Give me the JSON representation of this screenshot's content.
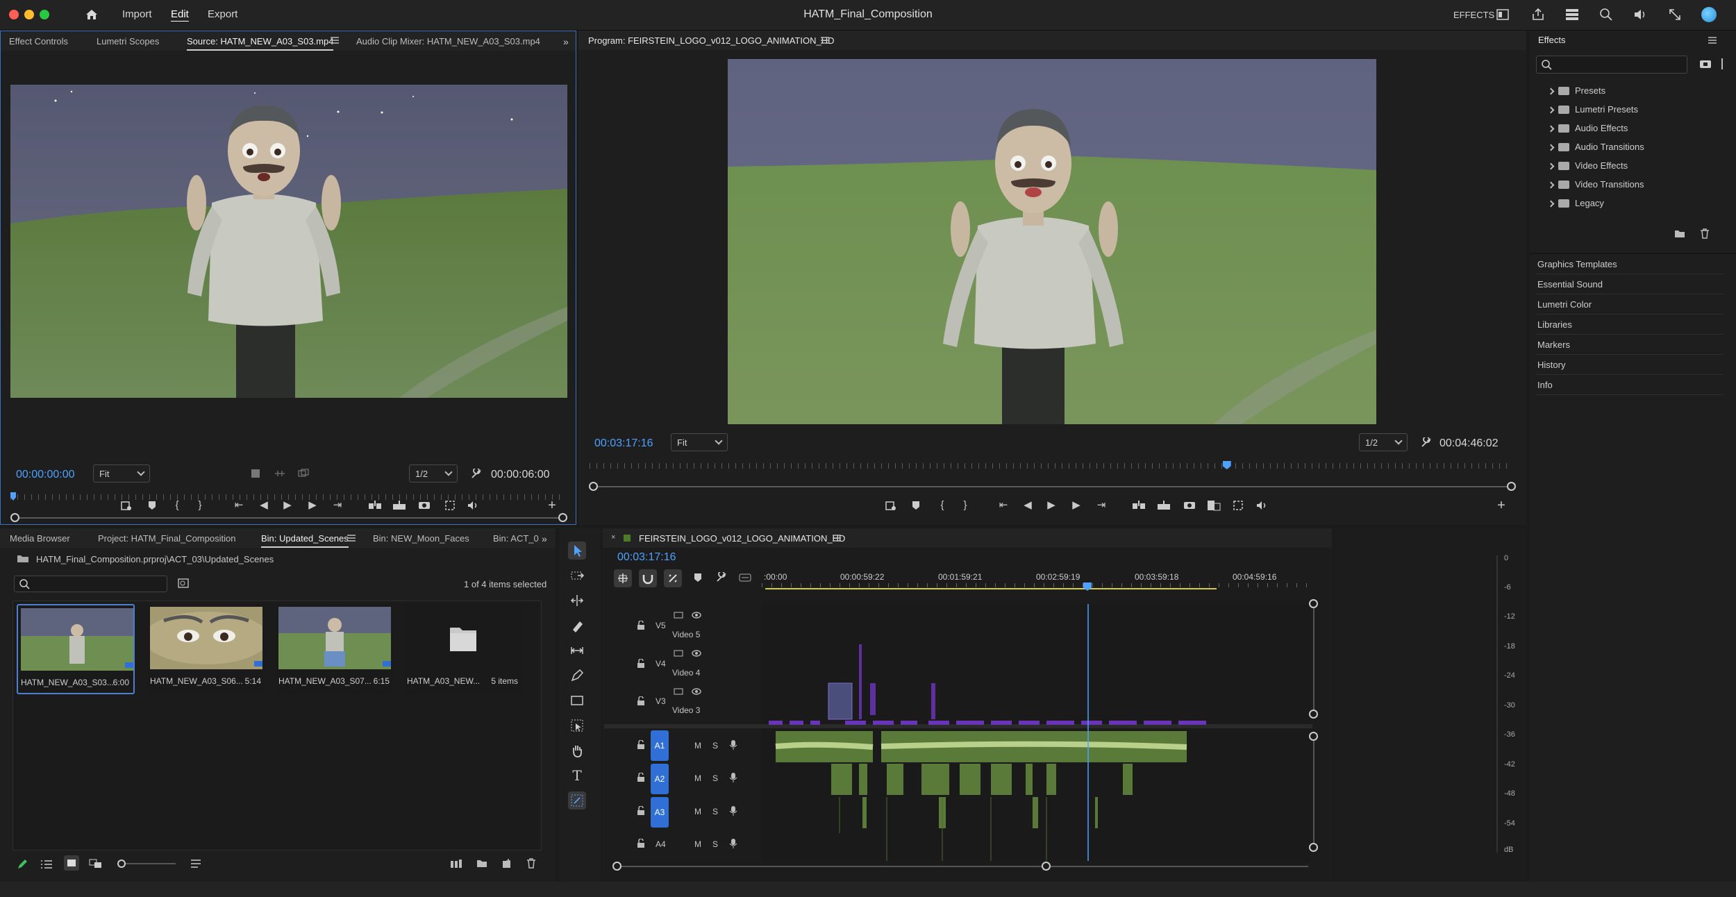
{
  "app": {
    "title": "HATM_Final_Composition",
    "menu": [
      "Import",
      "Edit",
      "Export"
    ],
    "workspace_label": "EFFECTS"
  },
  "source_panel": {
    "tabs": [
      "Effect Controls",
      "Lumetri Scopes",
      "Source: HATM_NEW_A03_S03.mp4",
      "Audio Clip Mixer: HATM_NEW_A03_S03.mp4"
    ],
    "timecode": "00:00:00:00",
    "fit": "Fit",
    "resolution": "1/2",
    "duration": "00:00:06:00"
  },
  "program_panel": {
    "title": "Program: FEIRSTEIN_LOGO_v012_LOGO_ANIMATION_HD",
    "timecode": "00:03:17:16",
    "fit": "Fit",
    "resolution": "1/2",
    "duration": "00:04:46:02",
    "playhead_fraction": 0.69
  },
  "effects_panel": {
    "title": "Effects",
    "search_placeholder": "",
    "folders": [
      "Presets",
      "Lumetri Presets",
      "Audio Effects",
      "Audio Transitions",
      "Video Effects",
      "Video Transitions",
      "Legacy"
    ],
    "sections": [
      "Graphics Templates",
      "Essential Sound",
      "Lumetri Color",
      "Libraries",
      "Markers",
      "History",
      "Info"
    ]
  },
  "project_panel": {
    "tabs": [
      "Media Browser",
      "Project: HATM_Final_Composition",
      "Bin: Updated_Scenes",
      "Bin: NEW_Moon_Faces",
      "Bin: ACT_0"
    ],
    "path": "HATM_Final_Composition.prproj\\ACT_03\\Updated_Scenes",
    "selection_status": "1 of 4 items selected",
    "items": [
      {
        "name": "HATM_NEW_A03_S03...",
        "meta": "6:00"
      },
      {
        "name": "HATM_NEW_A03_S06...",
        "meta": "5:14"
      },
      {
        "name": "HATM_NEW_A03_S07...",
        "meta": "6:15"
      },
      {
        "name": "HATM_A03_NEW...",
        "meta": "5 items"
      }
    ]
  },
  "timeline": {
    "sequence_name": "FEIRSTEIN_LOGO_v012_LOGO_ANIMATION_HD",
    "timecode": "00:03:17:16",
    "ruler_labels": [
      ":00:00",
      "00:00:59:22",
      "00:01:59:21",
      "00:02:59:19",
      "00:03:59:18",
      "00:04:59:16"
    ],
    "video_tracks": [
      {
        "id": "V5",
        "name": "Video 5"
      },
      {
        "id": "V4",
        "name": "Video 4"
      },
      {
        "id": "V3",
        "name": "Video 3"
      }
    ],
    "audio_tracks": [
      {
        "id": "A1",
        "m": "M",
        "s": "S"
      },
      {
        "id": "A2",
        "m": "M",
        "s": "S"
      },
      {
        "id": "A3",
        "m": "M",
        "s": "S"
      },
      {
        "id": "A4",
        "m": "M",
        "s": "S"
      }
    ]
  },
  "audio_meter": {
    "labels": [
      "0",
      "-6",
      "-12",
      "-18",
      "-24",
      "-30",
      "-36",
      "-42",
      "-48",
      "-54",
      "dB"
    ]
  },
  "colors": {
    "accent": "#4ea1ff",
    "track_target": "#2f6fd6",
    "audio_clip": "#5a7a3a",
    "video_clip": "#5d2fa0"
  }
}
